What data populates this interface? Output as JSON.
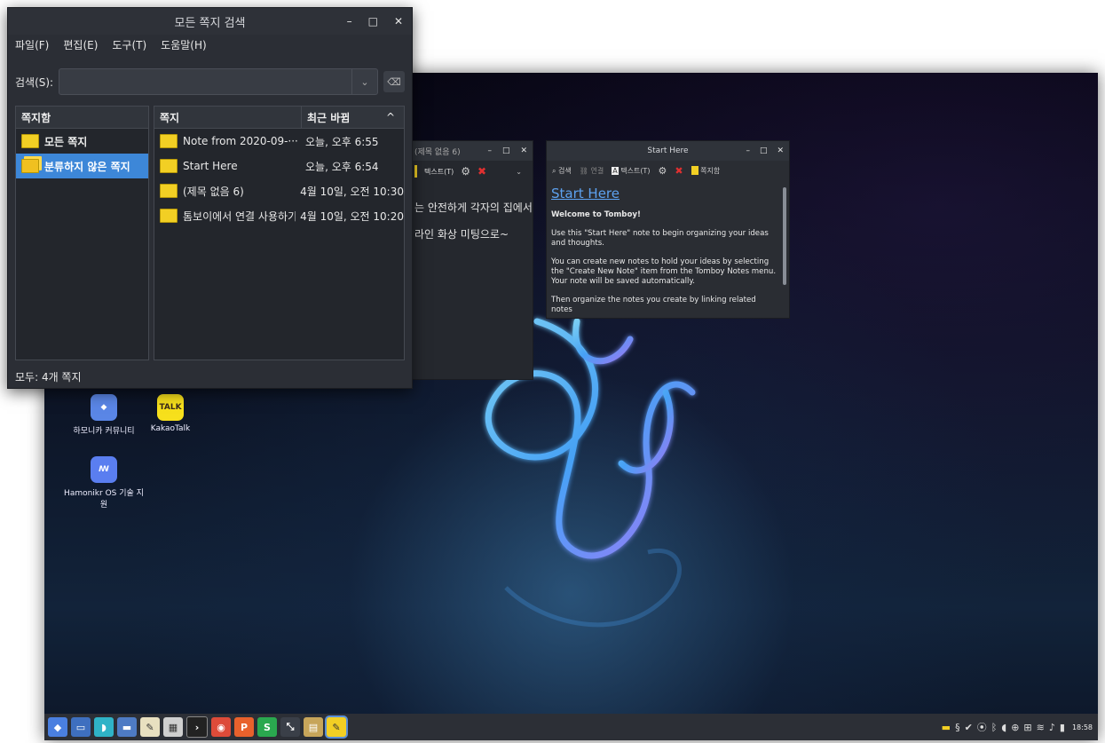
{
  "search_window": {
    "title": "모든 쪽지 검색",
    "controls": {
      "minimize": "–",
      "maximize": "□",
      "close": "✕"
    },
    "menu": [
      "파일(F)",
      "편집(E)",
      "도구(T)",
      "도움말(H)"
    ],
    "search_label": "검색(S):",
    "search_value": "",
    "notebooks_header": "쪽지함",
    "notebooks": [
      {
        "label": "모든 쪽지",
        "selected": false
      },
      {
        "label": "분류하지 않은 쪽지",
        "selected": true
      }
    ],
    "notes_header": "쪽지",
    "modified_header": "최근 바뀜",
    "sort_indicator": "^",
    "notes": [
      {
        "title": "Note from 2020-09-···",
        "date": "오늘, 오후 6:55"
      },
      {
        "title": "Start Here",
        "date": "오늘, 오후 6:54"
      },
      {
        "title": "(제목 없음 6)",
        "date": "4월 10일, 오전 10:30"
      },
      {
        "title": "톰보이에서 연결 사용하기",
        "date": "4월 10일, 오전 10:20"
      }
    ],
    "status": "모두: 4개 쪽지"
  },
  "note6_window": {
    "title": "(제목 없음 6)",
    "controls": {
      "minimize": "–",
      "maximize": "□",
      "close": "✕"
    },
    "toolbar": {
      "text": "텍스트(T)",
      "chevron": "⌄"
    },
    "lines": [
      "는 안전하게 각자의 집에서",
      "라인 화상 미팅으로~"
    ]
  },
  "start_window": {
    "title": "Start Here",
    "controls": {
      "minimize": "–",
      "maximize": "□",
      "close": "✕"
    },
    "toolbar": {
      "search": "검색",
      "link": "연결",
      "text": "텍스트(T)",
      "notebook": "쪽지함"
    },
    "note_title": "Start Here",
    "paragraphs": [
      "Welcome to Tomboy!",
      "Use this \"Start Here\" note to begin organizing your ideas and thoughts.",
      "You can create new notes to hold your ideas by selecting the \"Create New Note\" item from the Tomboy Notes menu. Your note will be saved automatically.",
      "Then organize the notes you create by linking related notes"
    ]
  },
  "desktop_icons": [
    {
      "label": "하모니카 커뮤니티",
      "icon": "hamonikr-community-icon"
    },
    {
      "label": "KakaoTalk",
      "icon": "kakaotalk-icon",
      "badge": "TALK"
    },
    {
      "label": "Hamonikr OS 기술 지원",
      "icon": "hamonikr-support-icon"
    }
  ],
  "taskbar": {
    "clock": "18:58"
  }
}
